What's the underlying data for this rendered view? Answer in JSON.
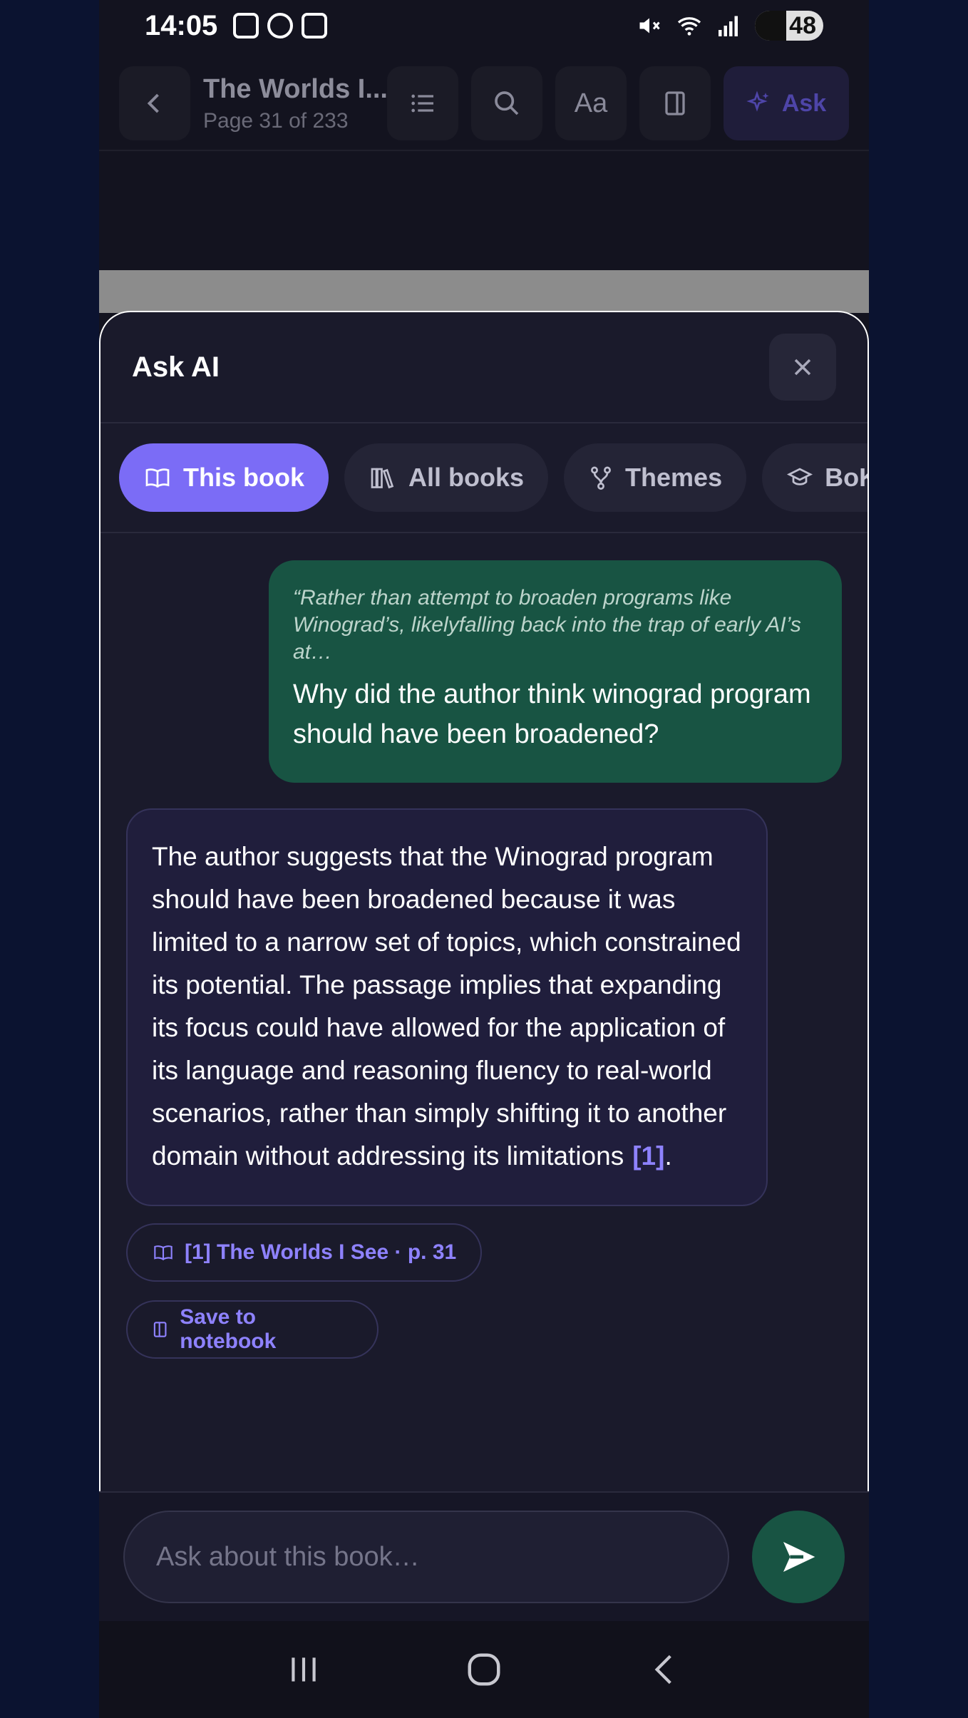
{
  "status_bar": {
    "time": "14:05",
    "battery": "48"
  },
  "reader_header": {
    "book_title": "The Worlds I...",
    "page_info": "Page 31 of 233",
    "font_button_label": "Aa",
    "ask_label": "Ask"
  },
  "sheet": {
    "title": "Ask AI",
    "tabs": [
      {
        "label": "This book",
        "icon": "book-icon",
        "active": true
      },
      {
        "label": "All books",
        "icon": "books-icon",
        "active": false
      },
      {
        "label": "Themes",
        "icon": "branch-icon",
        "active": false
      },
      {
        "label": "BoK",
        "icon": "graduation-cap-icon",
        "active": false
      }
    ]
  },
  "chat": {
    "user_quote": "“Rather than attempt to broaden programs like Winograd’s, likelyfalling back into the trap of early AI’s at…",
    "user_question": "Why did the author think winograd program should have been broadened?",
    "ai_answer": "The author suggests that the Winograd program should have been broadened because it was limited to a narrow set of topics, which constrained its potential. The passage implies that expanding its focus could have allowed for the application of its language and reasoning fluency to real-world scenarios, rather than simply shifting it to another domain without addressing its limitations",
    "ai_citation": "[1]",
    "ai_answer_end": ".",
    "source_chip": "[1] The Worlds I See · p. 31",
    "save_label": "Save to notebook"
  },
  "input": {
    "placeholder": "Ask about this book…"
  }
}
